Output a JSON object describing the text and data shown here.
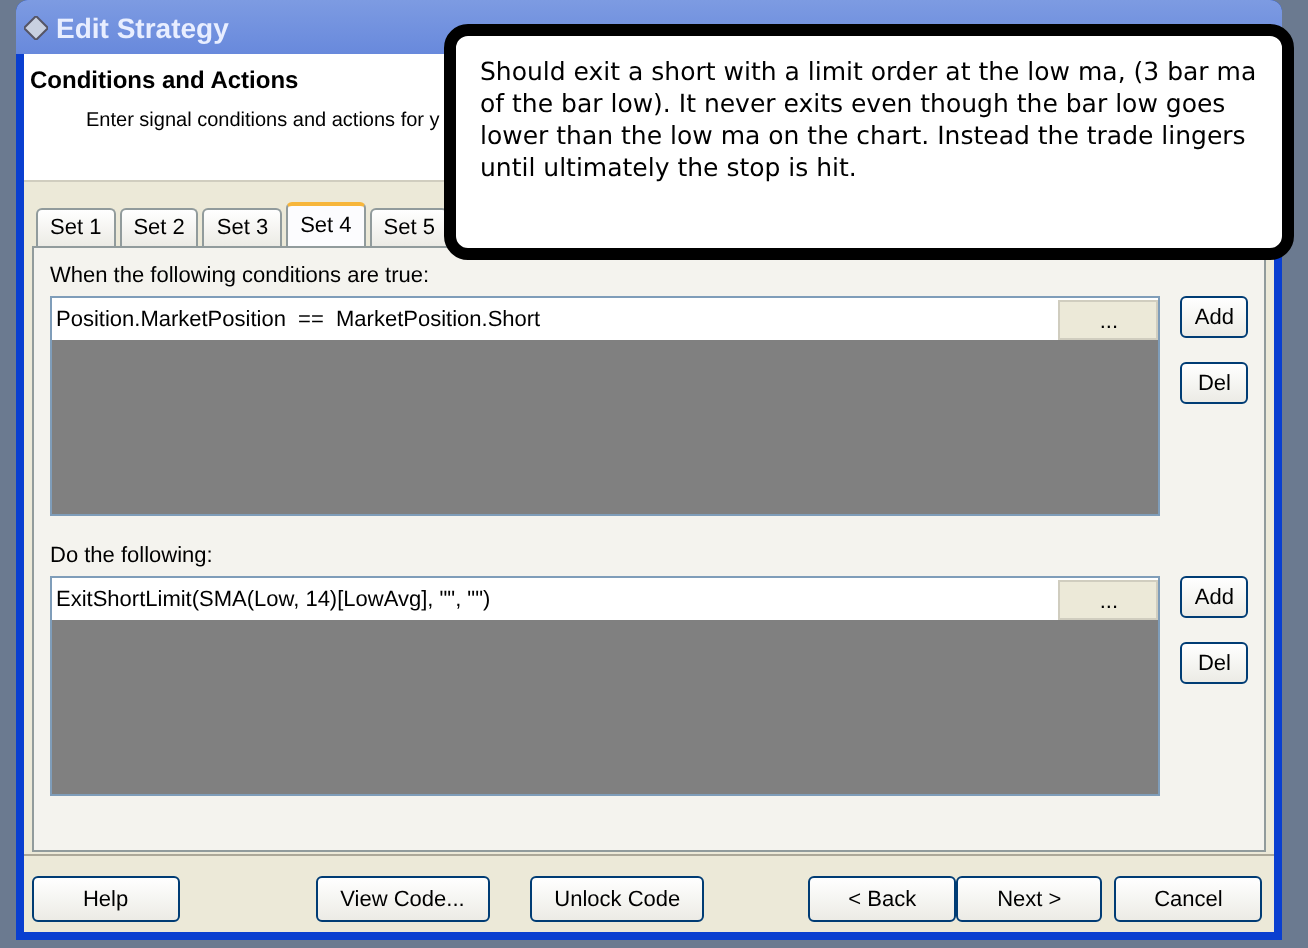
{
  "window": {
    "title": "Edit Strategy"
  },
  "header": {
    "title": "Conditions and Actions",
    "subtitle": "Enter signal conditions and actions for y"
  },
  "tabs": [
    {
      "label": "Set 1",
      "selected": false
    },
    {
      "label": "Set 2",
      "selected": false
    },
    {
      "label": "Set 3",
      "selected": false
    },
    {
      "label": "Set 4",
      "selected": true
    },
    {
      "label": "Set 5",
      "selected": false
    }
  ],
  "sections": [
    {
      "label": "When the following conditions are true:",
      "rows": [
        "Position.MarketPosition  ==  MarketPosition.Short"
      ],
      "browse_button": "...",
      "buttons": [
        "Add",
        "Del"
      ]
    },
    {
      "label": "Do the following:",
      "rows": [
        "ExitShortLimit(SMA(Low, 14)[LowAvg], \"\", \"\")"
      ],
      "browse_button": "...",
      "buttons": [
        "Add",
        "Del"
      ]
    }
  ],
  "footer_buttons": [
    "Help",
    "View Code...",
    "Unlock Code",
    "< Back",
    "Next >",
    "Cancel"
  ],
  "callout": {
    "text": "Should exit a short with a limit order at the low ma, (3 bar ma of the bar low).  It never exits even though the bar low goes lower than the low ma on the chart.  Instead the trade lingers until ultimately the stop is hit."
  }
}
